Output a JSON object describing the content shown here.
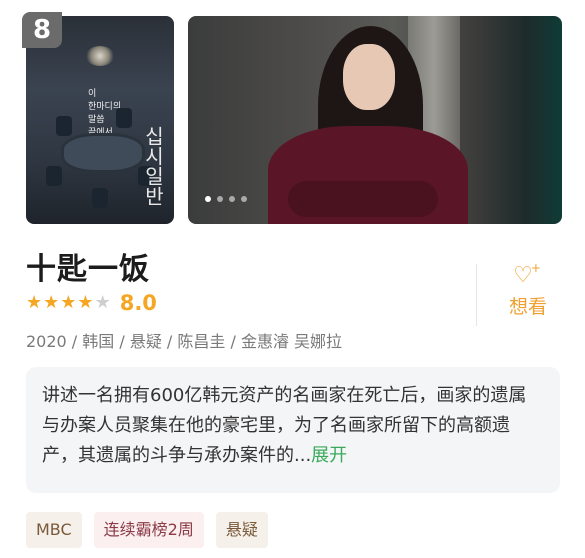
{
  "rank": "8",
  "poster": {
    "text_lines": [
      "이",
      "한마디의",
      "말씀",
      "끝에서",
      "다른",
      "게"
    ],
    "vertical_title": "십시일반"
  },
  "carousel": {
    "count": 4,
    "active_index": 0
  },
  "title": "十匙一饭",
  "rating": {
    "stars": 4,
    "max_stars": 5,
    "score": "8.0"
  },
  "want": {
    "label": "想看",
    "icon": "heart-plus-icon"
  },
  "meta": "2020 / 韩国 / 悬疑 / 陈昌圭 / 金惠濬 吴娜拉",
  "synopsis": {
    "text": "讲述一名拥有600亿韩元资产的名画家在死亡后，画家的遗属与办案人员聚集在他的豪宅里，为了名画家所留下的高额遗产，其遗属的斗争与承办案件的...",
    "expand_label": "展开"
  },
  "tags": [
    "MBC",
    "连续霸榜2周",
    "悬疑"
  ],
  "colors": {
    "accent": "#f5a623",
    "want": "#f0a030",
    "expand": "#3aa95a"
  }
}
